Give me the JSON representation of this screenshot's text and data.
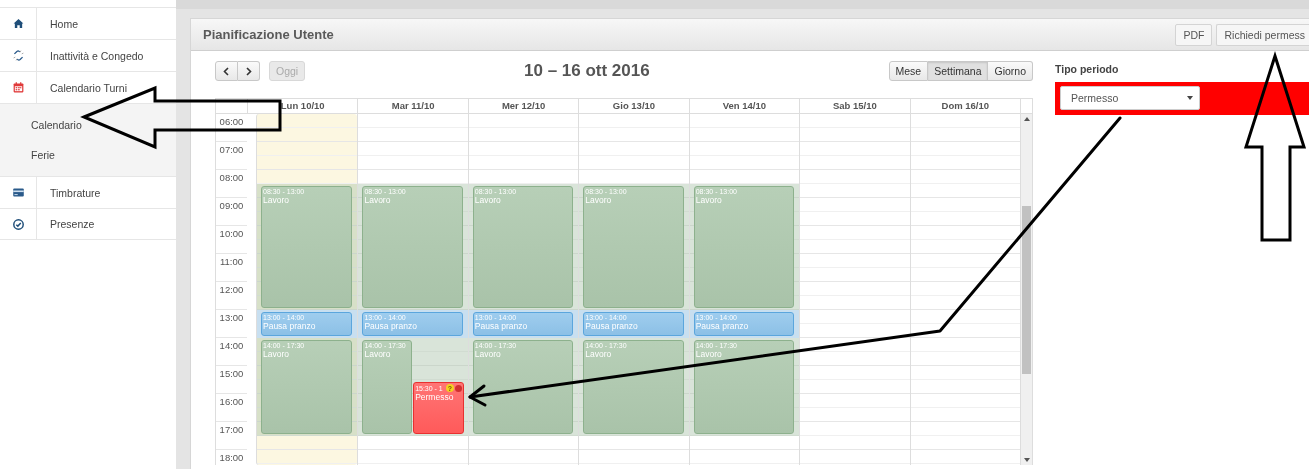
{
  "sidebar": {
    "items": [
      {
        "label": "Home",
        "kind": "home"
      },
      {
        "label": "Inattività e Congedo",
        "kind": "link"
      },
      {
        "label": "Calendario Turni",
        "kind": "calendar",
        "children": [
          {
            "label": "Calendario"
          },
          {
            "label": "Ferie"
          }
        ]
      },
      {
        "label": "Timbrature",
        "kind": "card"
      },
      {
        "label": "Presenze",
        "kind": "check"
      }
    ]
  },
  "panel": {
    "title": "Pianificazione Utente",
    "buttons": [
      "PDF",
      "Richiedi permess"
    ]
  },
  "calendar": {
    "today_button": {
      "label": "Oggi",
      "disabled": true
    },
    "range_title": "10 – 16 ott 2016",
    "views": [
      {
        "label": "Mese",
        "selected": false
      },
      {
        "label": "Settimana",
        "selected": true
      },
      {
        "label": "Giorno",
        "selected": false
      }
    ],
    "hours": [
      "06:00",
      "07:00",
      "08:00",
      "09:00",
      "10:00",
      "11:00",
      "12:00",
      "13:00",
      "14:00",
      "15:00",
      "16:00",
      "17:00",
      "18:00"
    ],
    "days": [
      {
        "label": "Lun 10/10",
        "today": true,
        "events": [
          {
            "kind": "work",
            "time": "08:30 - 13:00",
            "title": "Lavoro"
          },
          {
            "kind": "break",
            "time": "13:00 - 14:00",
            "title": "Pausa pranzo"
          },
          {
            "kind": "work",
            "time": "14:00 - 17:30",
            "title": "Lavoro"
          }
        ]
      },
      {
        "label": "Mar 11/10",
        "today": false,
        "events": [
          {
            "kind": "work",
            "time": "08:30 - 13:00",
            "title": "Lavoro"
          },
          {
            "kind": "break",
            "time": "13:00 - 14:00",
            "title": "Pausa pranzo"
          },
          {
            "kind": "work",
            "time": "14:00 - 17:30",
            "title": "Lavoro"
          },
          {
            "kind": "leave",
            "time": "15:30 - 1",
            "title": "Permesso",
            "badge": "?"
          }
        ]
      },
      {
        "label": "Mer 12/10",
        "today": false,
        "events": [
          {
            "kind": "work",
            "time": "08:30 - 13:00",
            "title": "Lavoro"
          },
          {
            "kind": "break",
            "time": "13:00 - 14:00",
            "title": "Pausa pranzo"
          },
          {
            "kind": "work",
            "time": "14:00 - 17:30",
            "title": "Lavoro"
          }
        ]
      },
      {
        "label": "Gio 13/10",
        "today": false,
        "events": [
          {
            "kind": "work",
            "time": "08:30 - 13:00",
            "title": "Lavoro"
          },
          {
            "kind": "break",
            "time": "13:00 - 14:00",
            "title": "Pausa pranzo"
          },
          {
            "kind": "work",
            "time": "14:00 - 17:30",
            "title": "Lavoro"
          }
        ]
      },
      {
        "label": "Ven 14/10",
        "today": false,
        "events": [
          {
            "kind": "work",
            "time": "08:30 - 13:00",
            "title": "Lavoro"
          },
          {
            "kind": "break",
            "time": "13:00 - 14:00",
            "title": "Pausa pranzo"
          },
          {
            "kind": "work",
            "time": "14:00 - 17:30",
            "title": "Lavoro"
          }
        ]
      },
      {
        "label": "Sab 15/10",
        "today": false
      },
      {
        "label": "Dom 16/10",
        "today": false
      }
    ]
  },
  "period_type": {
    "label": "Tipo periodo",
    "value": "Permesso"
  }
}
